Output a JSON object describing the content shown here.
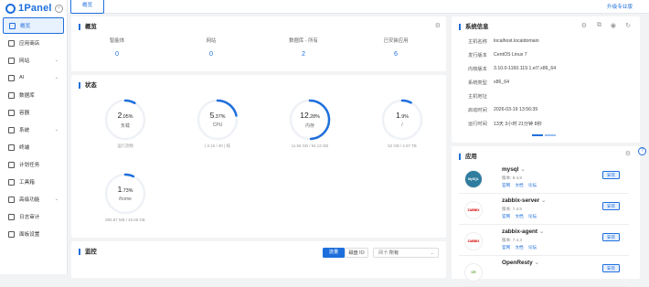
{
  "app": {
    "logo": "1Panel",
    "upgrade": "升级专业版",
    "tab": "概览"
  },
  "sidebar": {
    "items": [
      {
        "label": "概览",
        "active": true,
        "chev": false
      },
      {
        "label": "应用商店",
        "chev": false
      },
      {
        "label": "网站",
        "chev": true
      },
      {
        "label": "AI",
        "chev": true
      },
      {
        "label": "数据库",
        "chev": false
      },
      {
        "label": "容器",
        "chev": false
      },
      {
        "label": "系统",
        "chev": true
      },
      {
        "label": "终端",
        "chev": false
      },
      {
        "label": "计划任务",
        "chev": false
      },
      {
        "label": "工具箱",
        "chev": false
      },
      {
        "label": "高级功能",
        "chev": true
      },
      {
        "label": "日志审计",
        "chev": false
      },
      {
        "label": "面板设置",
        "chev": false
      }
    ]
  },
  "overview": {
    "title": "概览",
    "stats": [
      {
        "label": "智能体",
        "value": "0"
      },
      {
        "label": "网站",
        "value": "0"
      },
      {
        "label": "数据库 - 所有",
        "value": "2"
      },
      {
        "label": "已安装应用",
        "value": "6"
      }
    ]
  },
  "status": {
    "title": "状态",
    "gauges": [
      {
        "num": "2",
        "dec": ".05",
        "pct": "%",
        "label": "负载",
        "sub": "运行流畅",
        "fraction": 0.0205
      },
      {
        "num": "5",
        "dec": ".37",
        "pct": "%",
        "label": "CPU",
        "sub": "( 2.15 / 40 ) 核",
        "fraction": 0.0537
      },
      {
        "num": "12",
        "dec": ".28",
        "pct": "%",
        "label": "内存",
        "sub": "11.56 GB / 94.13 GB",
        "fraction": 0.1228
      },
      {
        "num": "1",
        "dec": ".9",
        "pct": "%",
        "label": "/",
        "sub": "52 GB / 2.67 TB",
        "fraction": 0.019
      },
      {
        "num": "1",
        "dec": ".73",
        "pct": "%",
        "label": "/home",
        "sub": "805.87 MB / 46.66 GB",
        "fraction": 0.0173
      }
    ]
  },
  "monitor": {
    "title": "监控",
    "btn_traffic": "流量",
    "btn_disk": "磁盘 IO",
    "nic_label": "网卡",
    "nic_value": "所有"
  },
  "sysinfo": {
    "title": "系统信息",
    "rows": [
      {
        "k": "主机名称",
        "v": "localhost.localdomain"
      },
      {
        "k": "发行版本",
        "v": "CentOS Linux 7"
      },
      {
        "k": "内核版本",
        "v": "3.10.0-1160.119.1.el7.x86_64"
      },
      {
        "k": "系统类型",
        "v": "x86_64"
      },
      {
        "k": "主机地址",
        "v": ""
      },
      {
        "k": "启动时间",
        "v": "2026-03-19 13:56:39"
      },
      {
        "k": "运行时间",
        "v": "13天 3小时 21分钟 8秒"
      }
    ]
  },
  "apps": {
    "title": "应用",
    "items": [
      {
        "name": "mysql",
        "ver": "版本: 8.4.8",
        "links": "官网 文档 论坛",
        "install": "安装",
        "color": "#2e7c9e",
        "logo": "MySQL"
      },
      {
        "name": "zabbix-server",
        "ver": "版本: 7.4.5",
        "links": "官网 文档 论坛",
        "install": "安装",
        "color": "#d40000",
        "logo": "ZABBIX"
      },
      {
        "name": "zabbix-agent",
        "ver": "版本: 7.4.3",
        "links": "官网 文档 论坛",
        "install": "安装",
        "color": "#d40000",
        "logo": "ZABBIX"
      },
      {
        "name": "OpenResty",
        "ver": "",
        "links": "",
        "install": "安装",
        "color": "#5aa832",
        "logo": "OR"
      }
    ]
  }
}
